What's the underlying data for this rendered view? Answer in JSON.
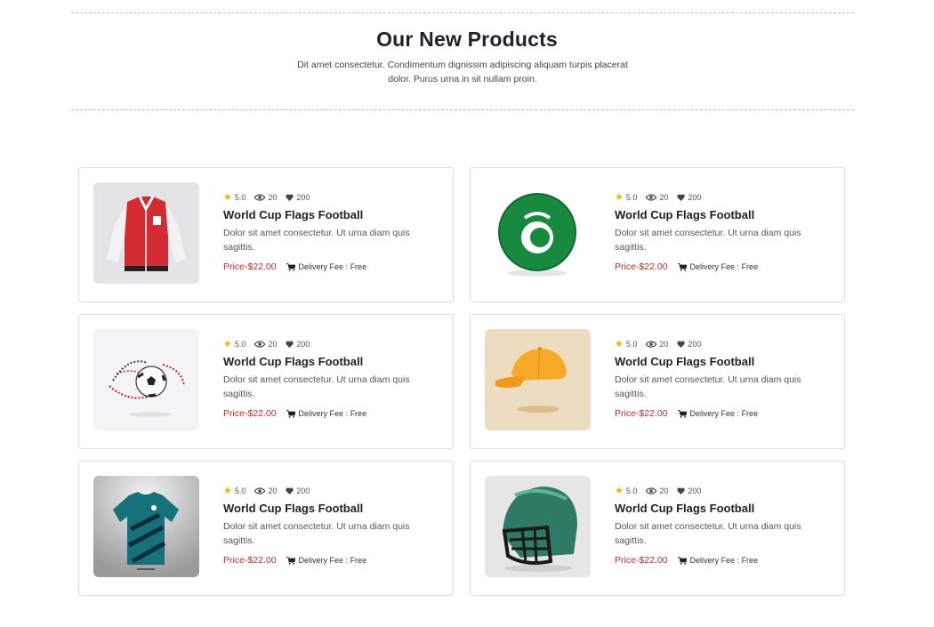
{
  "header": {
    "title": "Our New Products",
    "subtitle": "Dit amet consectetur. Condimentum dignissim adipiscing aliquam turpis placerat dolor. Purus urna in sit nullam proin."
  },
  "products": [
    {
      "image": "varsity-jacket-image",
      "rating": "5.0",
      "views": "20",
      "likes": "200",
      "name": "World Cup Flags Football",
      "description": "Dolor sit amet consectetur. Ut urna diam quis sagittis.",
      "price": "Price-$22.00",
      "delivery": "Delivery Fee : Free"
    },
    {
      "image": "green-ball-image",
      "rating": "5.0",
      "views": "20",
      "likes": "200",
      "name": "World Cup Flags Football",
      "description": "Dolor sit amet consectetur. Ut urna diam quis sagittis.",
      "price": "Price-$22.00",
      "delivery": "Delivery Fee : Free"
    },
    {
      "image": "soccer-ball-image",
      "rating": "5.0",
      "views": "20",
      "likes": "200",
      "name": "World Cup Flags Football",
      "description": "Dolor sit amet consectetur. Ut urna diam quis sagittis.",
      "price": "Price-$22.00",
      "delivery": "Delivery Fee : Free"
    },
    {
      "image": "orange-cap-image",
      "rating": "5.0",
      "views": "20",
      "likes": "200",
      "name": "World Cup Flags Football",
      "description": "Dolor sit amet consectetur. Ut urna diam quis sagittis.",
      "price": "Price-$22.00",
      "delivery": "Delivery Fee : Free"
    },
    {
      "image": "jersey-image",
      "rating": "5.0",
      "views": "20",
      "likes": "200",
      "name": "World Cup Flags Football",
      "description": "Dolor sit amet consectetur. Ut urna diam quis sagittis.",
      "price": "Price-$22.00",
      "delivery": "Delivery Fee : Free"
    },
    {
      "image": "helmet-image",
      "rating": "5.0",
      "views": "20",
      "likes": "200",
      "name": "World Cup Flags Football",
      "description": "Dolor sit amet consectetur. Ut urna diam quis sagittis.",
      "price": "Price-$22.00",
      "delivery": "Delivery Fee : Free"
    }
  ],
  "colors": {
    "price": "#c62828",
    "star": "#f4b400",
    "border": "#dcdcdc"
  },
  "icons": {
    "rating": "star-icon",
    "views": "eye-icon",
    "likes": "heart-icon",
    "delivery": "cart-icon"
  }
}
